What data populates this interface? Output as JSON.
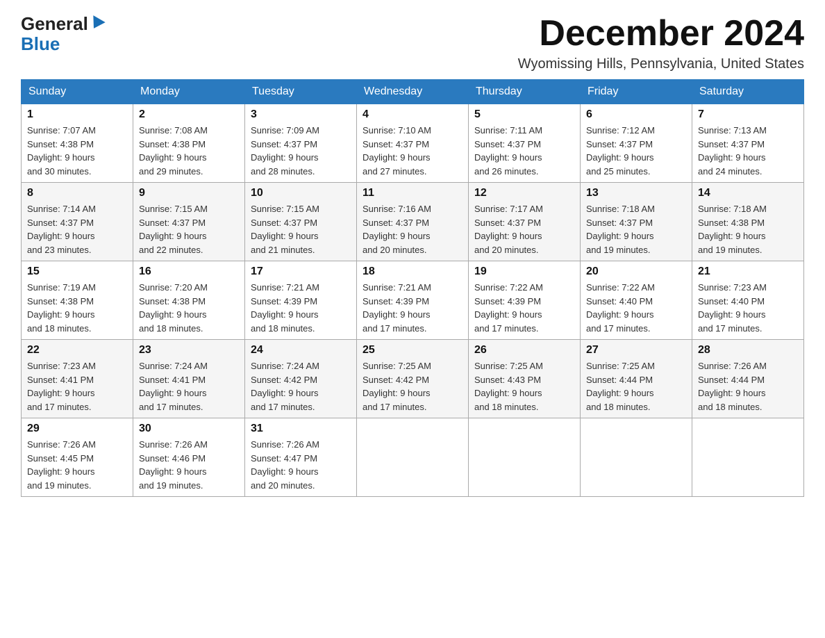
{
  "header": {
    "logo_general": "General",
    "logo_blue": "Blue",
    "month_title": "December 2024",
    "location": "Wyomissing Hills, Pennsylvania, United States"
  },
  "days_of_week": [
    "Sunday",
    "Monday",
    "Tuesday",
    "Wednesday",
    "Thursday",
    "Friday",
    "Saturday"
  ],
  "weeks": [
    [
      {
        "day": "1",
        "sunrise": "7:07 AM",
        "sunset": "4:38 PM",
        "daylight": "9 hours and 30 minutes."
      },
      {
        "day": "2",
        "sunrise": "7:08 AM",
        "sunset": "4:38 PM",
        "daylight": "9 hours and 29 minutes."
      },
      {
        "day": "3",
        "sunrise": "7:09 AM",
        "sunset": "4:37 PM",
        "daylight": "9 hours and 28 minutes."
      },
      {
        "day": "4",
        "sunrise": "7:10 AM",
        "sunset": "4:37 PM",
        "daylight": "9 hours and 27 minutes."
      },
      {
        "day": "5",
        "sunrise": "7:11 AM",
        "sunset": "4:37 PM",
        "daylight": "9 hours and 26 minutes."
      },
      {
        "day": "6",
        "sunrise": "7:12 AM",
        "sunset": "4:37 PM",
        "daylight": "9 hours and 25 minutes."
      },
      {
        "day": "7",
        "sunrise": "7:13 AM",
        "sunset": "4:37 PM",
        "daylight": "9 hours and 24 minutes."
      }
    ],
    [
      {
        "day": "8",
        "sunrise": "7:14 AM",
        "sunset": "4:37 PM",
        "daylight": "9 hours and 23 minutes."
      },
      {
        "day": "9",
        "sunrise": "7:15 AM",
        "sunset": "4:37 PM",
        "daylight": "9 hours and 22 minutes."
      },
      {
        "day": "10",
        "sunrise": "7:15 AM",
        "sunset": "4:37 PM",
        "daylight": "9 hours and 21 minutes."
      },
      {
        "day": "11",
        "sunrise": "7:16 AM",
        "sunset": "4:37 PM",
        "daylight": "9 hours and 20 minutes."
      },
      {
        "day": "12",
        "sunrise": "7:17 AM",
        "sunset": "4:37 PM",
        "daylight": "9 hours and 20 minutes."
      },
      {
        "day": "13",
        "sunrise": "7:18 AM",
        "sunset": "4:37 PM",
        "daylight": "9 hours and 19 minutes."
      },
      {
        "day": "14",
        "sunrise": "7:18 AM",
        "sunset": "4:38 PM",
        "daylight": "9 hours and 19 minutes."
      }
    ],
    [
      {
        "day": "15",
        "sunrise": "7:19 AM",
        "sunset": "4:38 PM",
        "daylight": "9 hours and 18 minutes."
      },
      {
        "day": "16",
        "sunrise": "7:20 AM",
        "sunset": "4:38 PM",
        "daylight": "9 hours and 18 minutes."
      },
      {
        "day": "17",
        "sunrise": "7:21 AM",
        "sunset": "4:39 PM",
        "daylight": "9 hours and 18 minutes."
      },
      {
        "day": "18",
        "sunrise": "7:21 AM",
        "sunset": "4:39 PM",
        "daylight": "9 hours and 17 minutes."
      },
      {
        "day": "19",
        "sunrise": "7:22 AM",
        "sunset": "4:39 PM",
        "daylight": "9 hours and 17 minutes."
      },
      {
        "day": "20",
        "sunrise": "7:22 AM",
        "sunset": "4:40 PM",
        "daylight": "9 hours and 17 minutes."
      },
      {
        "day": "21",
        "sunrise": "7:23 AM",
        "sunset": "4:40 PM",
        "daylight": "9 hours and 17 minutes."
      }
    ],
    [
      {
        "day": "22",
        "sunrise": "7:23 AM",
        "sunset": "4:41 PM",
        "daylight": "9 hours and 17 minutes."
      },
      {
        "day": "23",
        "sunrise": "7:24 AM",
        "sunset": "4:41 PM",
        "daylight": "9 hours and 17 minutes."
      },
      {
        "day": "24",
        "sunrise": "7:24 AM",
        "sunset": "4:42 PM",
        "daylight": "9 hours and 17 minutes."
      },
      {
        "day": "25",
        "sunrise": "7:25 AM",
        "sunset": "4:42 PM",
        "daylight": "9 hours and 17 minutes."
      },
      {
        "day": "26",
        "sunrise": "7:25 AM",
        "sunset": "4:43 PM",
        "daylight": "9 hours and 18 minutes."
      },
      {
        "day": "27",
        "sunrise": "7:25 AM",
        "sunset": "4:44 PM",
        "daylight": "9 hours and 18 minutes."
      },
      {
        "day": "28",
        "sunrise": "7:26 AM",
        "sunset": "4:44 PM",
        "daylight": "9 hours and 18 minutes."
      }
    ],
    [
      {
        "day": "29",
        "sunrise": "7:26 AM",
        "sunset": "4:45 PM",
        "daylight": "9 hours and 19 minutes."
      },
      {
        "day": "30",
        "sunrise": "7:26 AM",
        "sunset": "4:46 PM",
        "daylight": "9 hours and 19 minutes."
      },
      {
        "day": "31",
        "sunrise": "7:26 AM",
        "sunset": "4:47 PM",
        "daylight": "9 hours and 20 minutes."
      },
      null,
      null,
      null,
      null
    ]
  ],
  "labels": {
    "sunrise": "Sunrise:",
    "sunset": "Sunset:",
    "daylight": "Daylight:"
  }
}
